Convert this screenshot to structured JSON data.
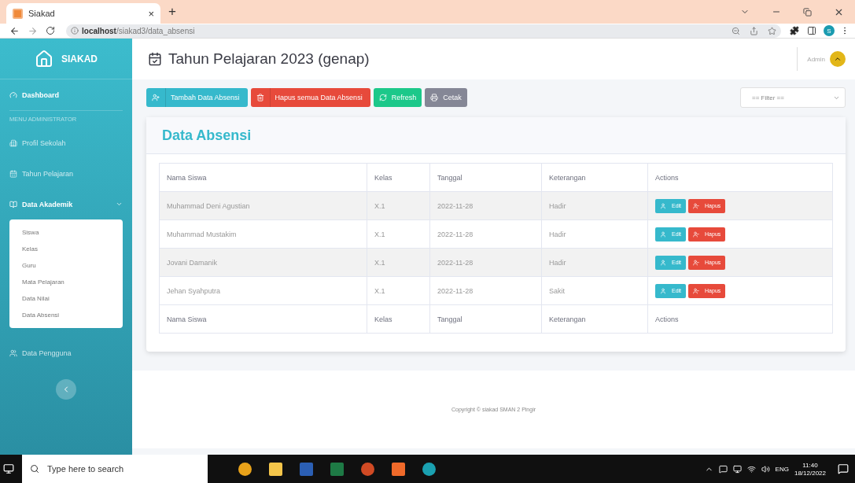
{
  "browser": {
    "tab_title": "Siakad",
    "tab_close": "×",
    "new_tab": "+",
    "url_host": "localhost",
    "url_path": "/siakad3/data_absensi",
    "profile": "S"
  },
  "sidebar": {
    "brand": "SIAKAD",
    "items": [
      {
        "kind": "link",
        "label": "Dashboard",
        "selected": true
      },
      {
        "kind": "heading",
        "label": "MENU ADMINISTRATOR"
      },
      {
        "kind": "link",
        "label": "Profil Sekolah",
        "selected": false
      },
      {
        "kind": "link",
        "label": "Tahun Pelajaran",
        "selected": false
      },
      {
        "kind": "group",
        "label": "Data Akademik",
        "selected": true,
        "expanded": true,
        "children": [
          {
            "label": "Siswa"
          },
          {
            "label": "Kelas"
          },
          {
            "label": "Guru"
          },
          {
            "label": "Mata Pelajaran"
          },
          {
            "label": "Data Nilai"
          },
          {
            "label": "Data Absensi"
          }
        ]
      },
      {
        "kind": "link",
        "label": "Data Pengguna",
        "selected": false
      }
    ]
  },
  "header": {
    "title": "Tahun Pelajaran 2023 (genap)",
    "user": "Admin"
  },
  "toolbar": {
    "buttons": [
      {
        "label": "Tambah Data Absensi",
        "kind": "add"
      },
      {
        "label": "Hapus semua Data Absensi",
        "kind": "delete"
      },
      {
        "label": "Refresh",
        "kind": "refresh"
      },
      {
        "label": "Cetak",
        "kind": "print"
      }
    ],
    "filter": "== Filter =="
  },
  "card": {
    "title": "Data Absensi",
    "columns": [
      "Nama Siswa",
      "Kelas",
      "Tanggal",
      "Keterangan",
      "Actions"
    ],
    "rows": [
      {
        "cells": [
          "Muhammad Deni Agustian",
          "X.1",
          "2022-11-28",
          "Hadir"
        ],
        "actions": [
          "Edit",
          "Hapus"
        ]
      },
      {
        "cells": [
          "Muhammad Mustakim",
          "X.1",
          "2022-11-28",
          "Hadir"
        ],
        "actions": [
          "Edit",
          "Hapus"
        ]
      },
      {
        "cells": [
          "Jovani Damanik",
          "X.1",
          "2022-11-28",
          "Hadir"
        ],
        "actions": [
          "Edit",
          "Hapus"
        ]
      },
      {
        "cells": [
          "Jehan Syahputra",
          "X.1",
          "2022-11-28",
          "Sakit"
        ],
        "actions": [
          "Edit",
          "Hapus"
        ]
      }
    ],
    "footer_columns": [
      "Nama Siswa",
      "Kelas",
      "Tanggal",
      "Keterangan",
      "Actions"
    ]
  },
  "footer": "Copyright © siakad SMAN 2 Pingir",
  "taskbar": {
    "search_placeholder": "Type here to search",
    "language": "ENG",
    "time": "11:40",
    "date": "18/12/2022"
  }
}
